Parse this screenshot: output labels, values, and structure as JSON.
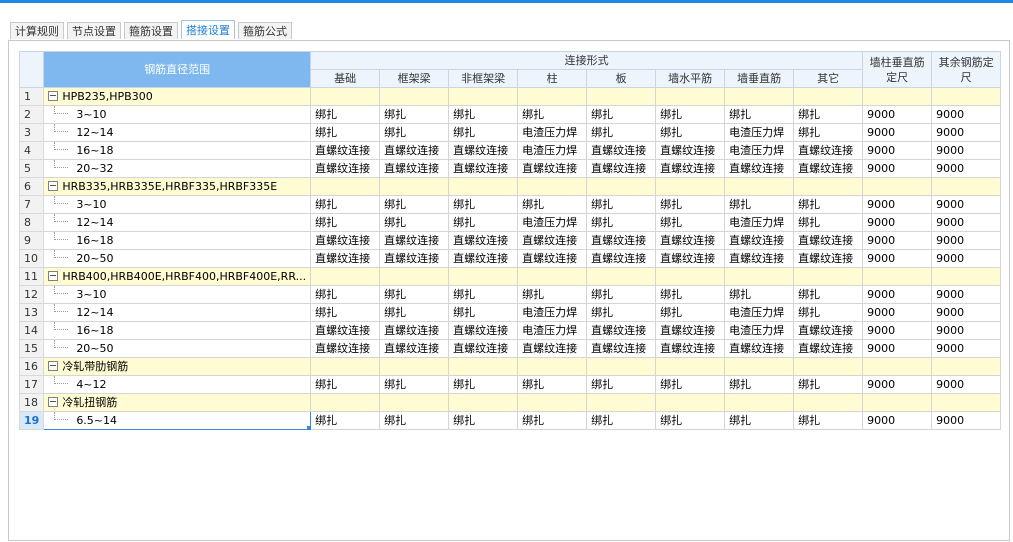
{
  "tabs": [
    {
      "label": "计算规则",
      "active": false
    },
    {
      "label": "节点设置",
      "active": false
    },
    {
      "label": "箍筋设置",
      "active": false
    },
    {
      "label": "搭接设置",
      "active": true
    },
    {
      "label": "箍筋公式",
      "active": false
    }
  ],
  "header": {
    "range": "钢筋直径范围",
    "connection_group": "连接形式",
    "connection_cols": [
      "基础",
      "框架梁",
      "非框架梁",
      "柱",
      "板",
      "墙水平筋",
      "墙垂直筋",
      "其它"
    ],
    "col_wall": "墙柱垂直筋定尺",
    "col_other": "其余钢筋定尺"
  },
  "rows": [
    {
      "num": "1",
      "type": "group",
      "label": "HPB235,HPB300"
    },
    {
      "num": "2",
      "type": "item",
      "label": "3~10",
      "cells": [
        "绑扎",
        "绑扎",
        "绑扎",
        "绑扎",
        "绑扎",
        "绑扎",
        "绑扎",
        "绑扎",
        "9000",
        "9000"
      ]
    },
    {
      "num": "3",
      "type": "item",
      "label": "12~14",
      "cells": [
        "绑扎",
        "绑扎",
        "绑扎",
        "电渣压力焊",
        "绑扎",
        "绑扎",
        "电渣压力焊",
        "绑扎",
        "9000",
        "9000"
      ]
    },
    {
      "num": "4",
      "type": "item",
      "label": "16~18",
      "cells": [
        "直螺纹连接",
        "直螺纹连接",
        "直螺纹连接",
        "电渣压力焊",
        "直螺纹连接",
        "直螺纹连接",
        "电渣压力焊",
        "直螺纹连接",
        "9000",
        "9000"
      ]
    },
    {
      "num": "5",
      "type": "item",
      "label": "20~32",
      "cells": [
        "直螺纹连接",
        "直螺纹连接",
        "直螺纹连接",
        "直螺纹连接",
        "直螺纹连接",
        "直螺纹连接",
        "直螺纹连接",
        "直螺纹连接",
        "9000",
        "9000"
      ]
    },
    {
      "num": "6",
      "type": "group",
      "label": "HRB335,HRB335E,HRBF335,HRBF335E"
    },
    {
      "num": "7",
      "type": "item",
      "label": "3~10",
      "cells": [
        "绑扎",
        "绑扎",
        "绑扎",
        "绑扎",
        "绑扎",
        "绑扎",
        "绑扎",
        "绑扎",
        "9000",
        "9000"
      ]
    },
    {
      "num": "8",
      "type": "item",
      "label": "12~14",
      "cells": [
        "绑扎",
        "绑扎",
        "绑扎",
        "电渣压力焊",
        "绑扎",
        "绑扎",
        "电渣压力焊",
        "绑扎",
        "9000",
        "9000"
      ]
    },
    {
      "num": "9",
      "type": "item",
      "label": "16~18",
      "cells": [
        "直螺纹连接",
        "直螺纹连接",
        "直螺纹连接",
        "直螺纹连接",
        "直螺纹连接",
        "直螺纹连接",
        "直螺纹连接",
        "直螺纹连接",
        "9000",
        "9000"
      ]
    },
    {
      "num": "10",
      "type": "item",
      "label": "20~50",
      "cells": [
        "直螺纹连接",
        "直螺纹连接",
        "直螺纹连接",
        "直螺纹连接",
        "直螺纹连接",
        "直螺纹连接",
        "直螺纹连接",
        "直螺纹连接",
        "9000",
        "9000"
      ]
    },
    {
      "num": "11",
      "type": "group",
      "label": "HRB400,HRB400E,HRBF400,HRBF400E,RR..."
    },
    {
      "num": "12",
      "type": "item",
      "label": "3~10",
      "cells": [
        "绑扎",
        "绑扎",
        "绑扎",
        "绑扎",
        "绑扎",
        "绑扎",
        "绑扎",
        "绑扎",
        "9000",
        "9000"
      ]
    },
    {
      "num": "13",
      "type": "item",
      "label": "12~14",
      "cells": [
        "绑扎",
        "绑扎",
        "绑扎",
        "电渣压力焊",
        "绑扎",
        "绑扎",
        "电渣压力焊",
        "绑扎",
        "9000",
        "9000"
      ]
    },
    {
      "num": "14",
      "type": "item",
      "label": "16~18",
      "cells": [
        "直螺纹连接",
        "直螺纹连接",
        "直螺纹连接",
        "电渣压力焊",
        "直螺纹连接",
        "直螺纹连接",
        "电渣压力焊",
        "直螺纹连接",
        "9000",
        "9000"
      ]
    },
    {
      "num": "15",
      "type": "item",
      "label": "20~50",
      "cells": [
        "直螺纹连接",
        "直螺纹连接",
        "直螺纹连接",
        "直螺纹连接",
        "直螺纹连接",
        "直螺纹连接",
        "直螺纹连接",
        "直螺纹连接",
        "9000",
        "9000"
      ]
    },
    {
      "num": "16",
      "type": "group",
      "label": "冷轧带肋钢筋"
    },
    {
      "num": "17",
      "type": "item",
      "label": "4~12",
      "cells": [
        "绑扎",
        "绑扎",
        "绑扎",
        "绑扎",
        "绑扎",
        "绑扎",
        "绑扎",
        "绑扎",
        "9000",
        "9000"
      ]
    },
    {
      "num": "18",
      "type": "group",
      "label": "冷轧扭钢筋"
    },
    {
      "num": "19",
      "type": "item",
      "label": "6.5~14",
      "current": true,
      "cells": [
        "绑扎",
        "绑扎",
        "绑扎",
        "绑扎",
        "绑扎",
        "绑扎",
        "绑扎",
        "绑扎",
        "9000",
        "9000"
      ]
    }
  ]
}
